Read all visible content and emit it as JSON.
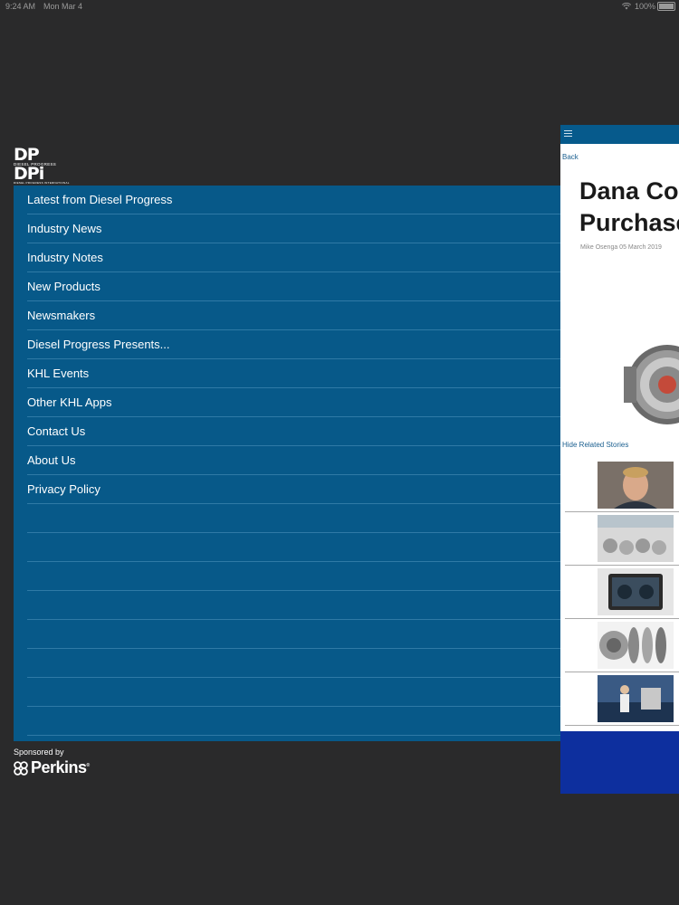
{
  "status_bar": {
    "time": "9:24 AM",
    "date": "Mon Mar 4",
    "battery": "100%"
  },
  "logo": {
    "line1": "DP",
    "line2": "DIESEL PROGRESS",
    "line3": "DPi",
    "line4": "DIESEL PROGRESS INTERNATIONAL"
  },
  "menu": {
    "items": [
      "Latest from Diesel Progress",
      "Industry News",
      "Industry Notes",
      "New Products",
      "Newsmakers",
      "Diesel Progress Presents...",
      "KHL Events",
      "Other KHL Apps",
      "Contact Us",
      "About Us",
      "Privacy Policy"
    ],
    "empty_rows": 8
  },
  "sponsor": {
    "label": "Sponsored by",
    "brand": "Perkins",
    "reg_mark": "®"
  },
  "article": {
    "back": "Back",
    "title_line1": "Dana Cor",
    "title_line2": "Purchase",
    "byline": "Mike Osenga 05 March 2019",
    "hide_related": "Hide Related Stories"
  },
  "icons": [
    "hamburger-menu-icon",
    "wifi-icon",
    "battery-icon",
    "perkins-logo-icon"
  ],
  "colors": {
    "background": "#2a2a2b",
    "menu": "#075989",
    "panel_header": "#065a8c",
    "panel_footer": "#0d2f9e",
    "link": "#1a5f8f"
  }
}
